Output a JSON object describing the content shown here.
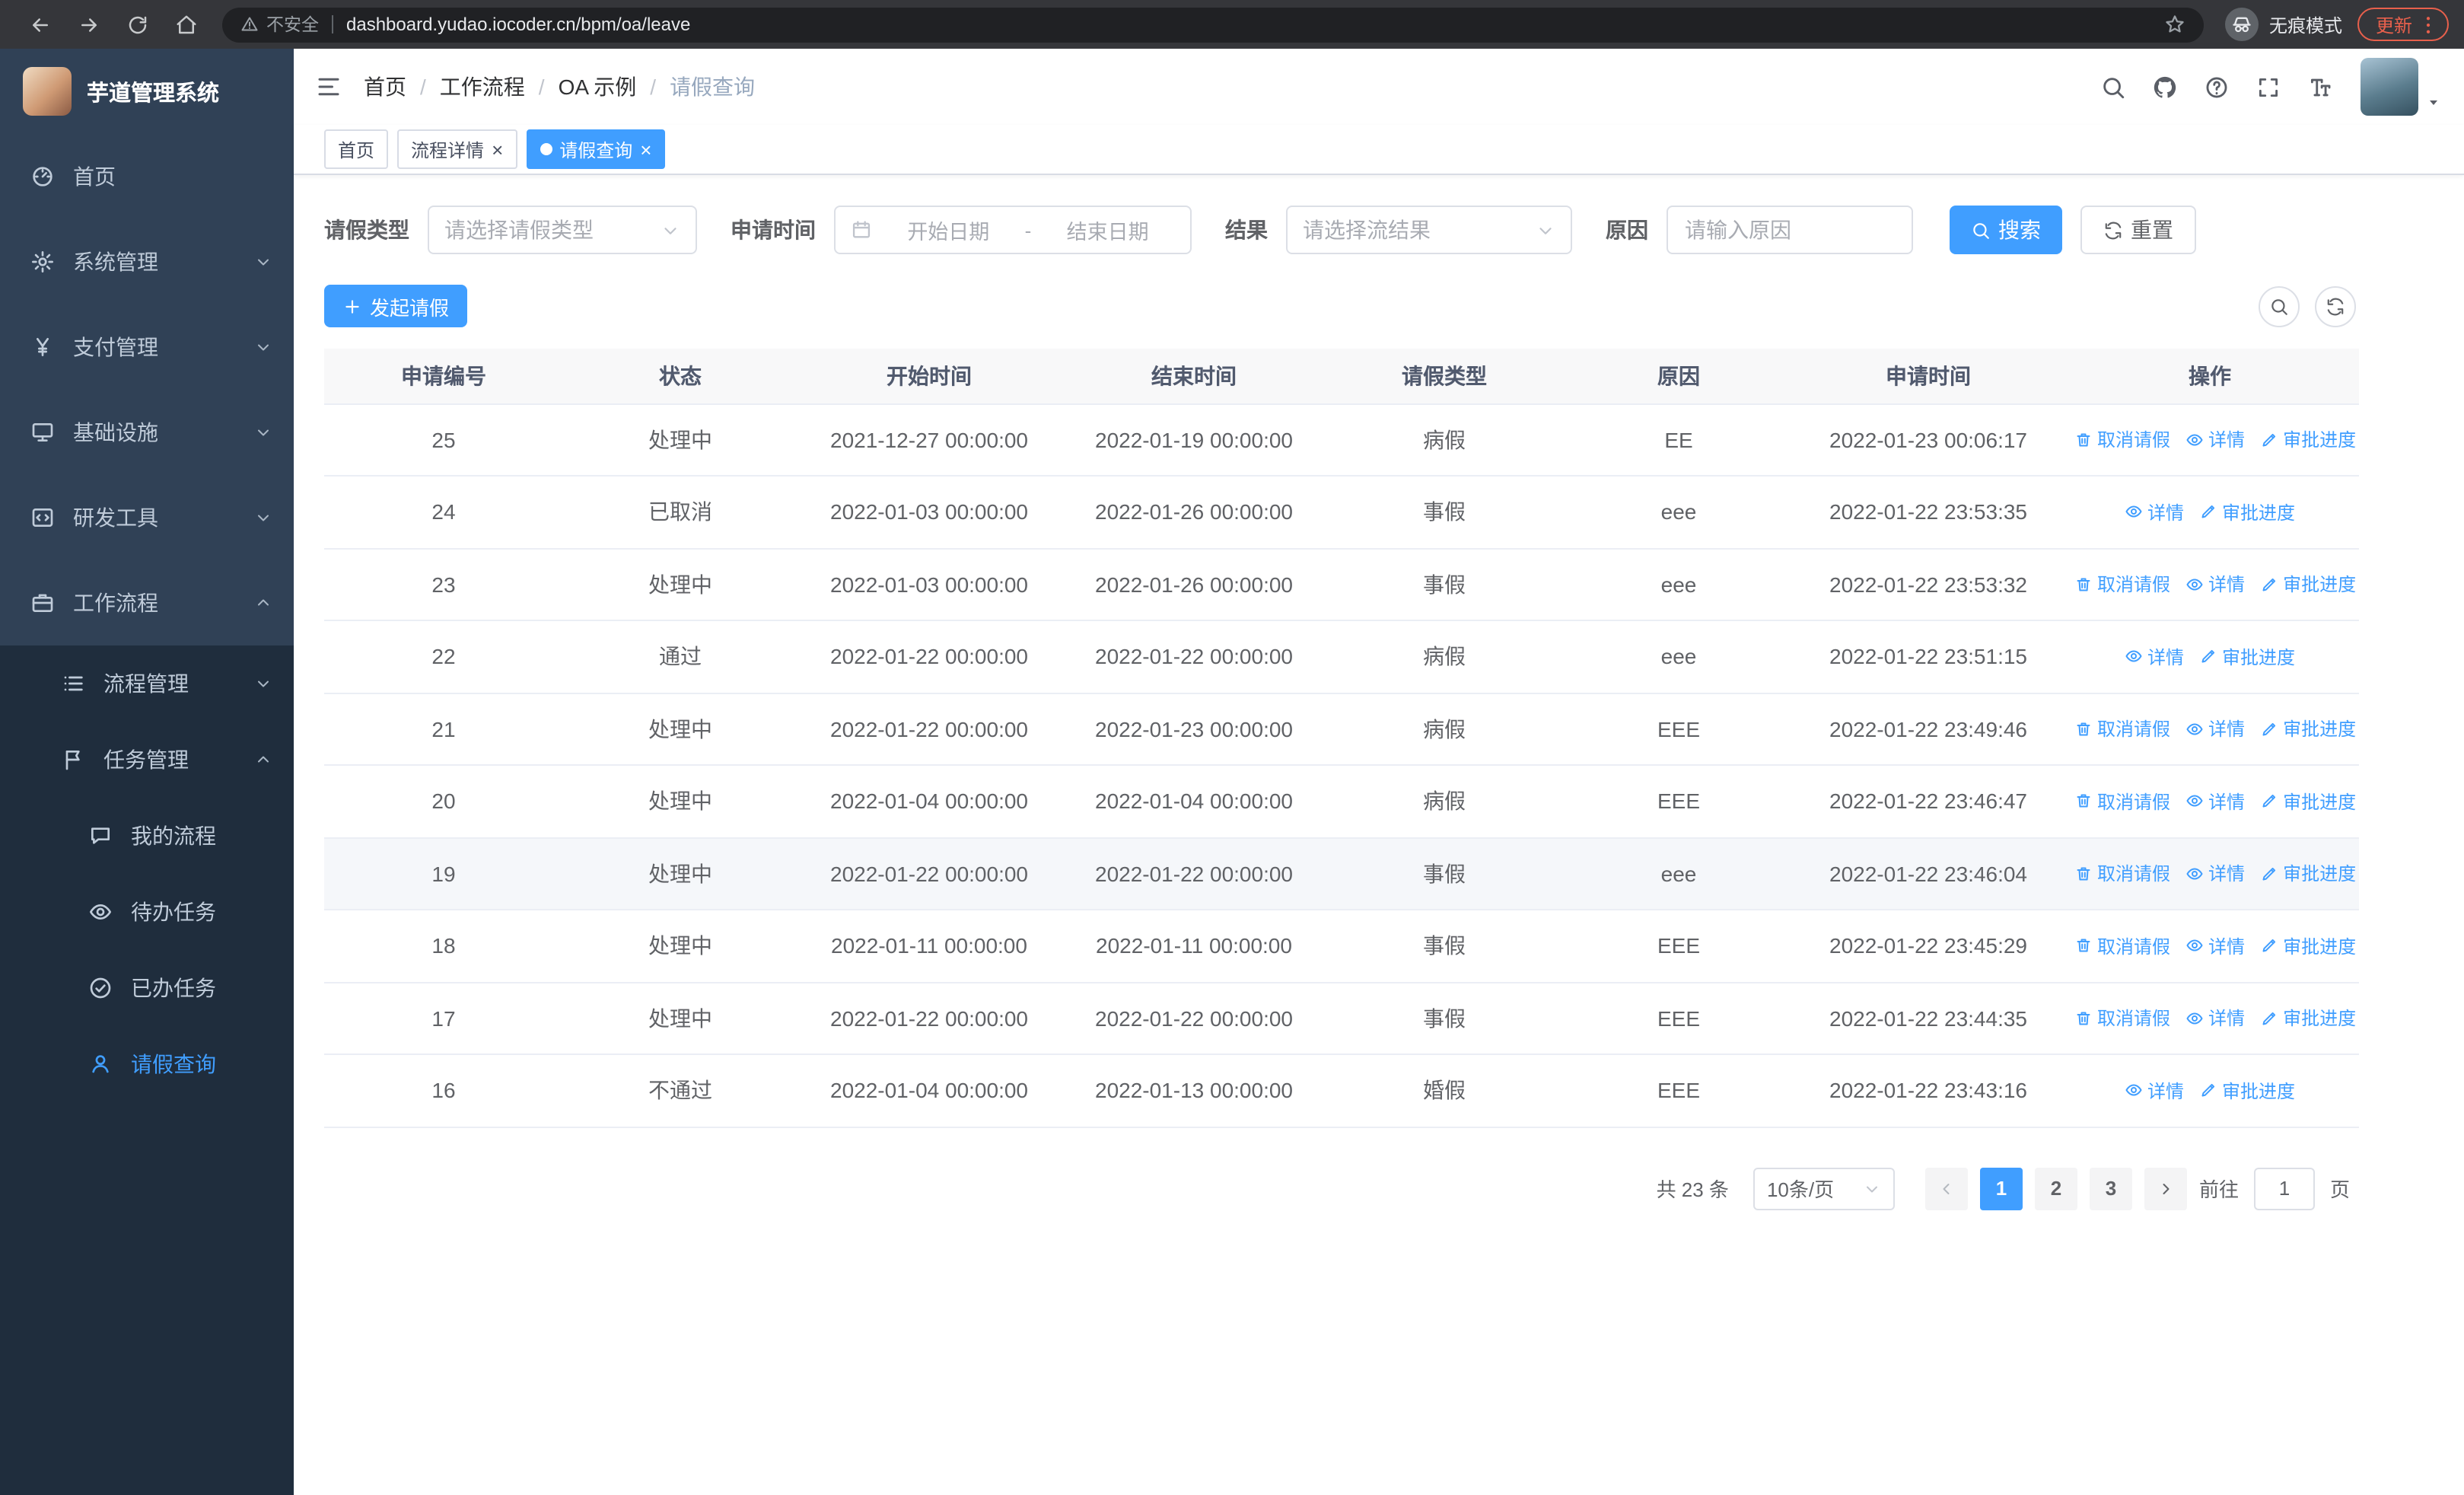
{
  "browser": {
    "security_warning": "不安全",
    "url": "dashboard.yudao.iocoder.cn/bpm/oa/leave",
    "incognito_label": "无痕模式",
    "update_label": "更新"
  },
  "sidebar": {
    "logo_title": "芋道管理系统",
    "items": [
      {
        "name": "home",
        "label": "首页",
        "icon": "dashboard-icon",
        "level": 0
      },
      {
        "name": "system-management",
        "label": "系统管理",
        "icon": "gear-icon",
        "level": 0,
        "arrow": "down"
      },
      {
        "name": "payment-management",
        "label": "支付管理",
        "icon": "yen-icon",
        "level": 0,
        "arrow": "down"
      },
      {
        "name": "infrastructure",
        "label": "基础设施",
        "icon": "monitor-icon",
        "level": 0,
        "arrow": "down"
      },
      {
        "name": "dev-tools",
        "label": "研发工具",
        "icon": "devtools-icon",
        "level": 0,
        "arrow": "down"
      },
      {
        "name": "workflow",
        "label": "工作流程",
        "icon": "briefcase-icon",
        "level": 0,
        "arrow": "up"
      },
      {
        "name": "process-management",
        "label": "流程管理",
        "icon": "list-icon",
        "level": 1,
        "arrow": "down"
      },
      {
        "name": "task-management",
        "label": "任务管理",
        "icon": "flag-icon",
        "level": 1,
        "arrow": "up"
      },
      {
        "name": "my-process",
        "label": "我的流程",
        "icon": "chat-icon",
        "level": 2
      },
      {
        "name": "todo-tasks",
        "label": "待办任务",
        "icon": "eye-icon",
        "level": 2
      },
      {
        "name": "done-tasks",
        "label": "已办任务",
        "icon": "check-circle-icon",
        "level": 2
      },
      {
        "name": "leave-query",
        "label": "请假查询",
        "icon": "user-icon",
        "level": 2,
        "active": true
      }
    ]
  },
  "header": {
    "breadcrumb": [
      "首页",
      "工作流程",
      "OA 示例",
      "请假查询"
    ]
  },
  "tabs": [
    {
      "label": "首页",
      "closable": false,
      "active": false
    },
    {
      "label": "流程详情",
      "closable": true,
      "active": false
    },
    {
      "label": "请假查询",
      "closable": true,
      "active": true
    }
  ],
  "filters": {
    "leave_type_label": "请假类型",
    "leave_type_placeholder": "请选择请假类型",
    "apply_time_label": "申请时间",
    "start_date_placeholder": "开始日期",
    "date_separator": "-",
    "end_date_placeholder": "结束日期",
    "result_label": "结果",
    "result_placeholder": "请选择流结果",
    "reason_label": "原因",
    "reason_placeholder": "请输入原因",
    "search_label": "搜索",
    "reset_label": "重置"
  },
  "toolbar": {
    "create_label": "发起请假"
  },
  "actions": {
    "cancel": {
      "label": "取消请假",
      "icon": "trash-icon"
    },
    "detail": {
      "label": "详情",
      "icon": "eye-icon"
    },
    "progress": {
      "label": "审批进度",
      "icon": "edit-icon"
    }
  },
  "table": {
    "columns": [
      "申请编号",
      "状态",
      "开始时间",
      "结束时间",
      "请假类型",
      "原因",
      "申请时间",
      "操作"
    ],
    "rows": [
      {
        "id": "25",
        "status": "处理中",
        "start": "2021-12-27 00:00:00",
        "end": "2022-01-19 00:00:00",
        "type": "病假",
        "reason": "EE",
        "applied": "2022-01-23 00:06:17",
        "actions": [
          "cancel",
          "detail",
          "progress"
        ]
      },
      {
        "id": "24",
        "status": "已取消",
        "start": "2022-01-03 00:00:00",
        "end": "2022-01-26 00:00:00",
        "type": "事假",
        "reason": "eee",
        "applied": "2022-01-22 23:53:35",
        "actions": [
          "detail",
          "progress"
        ]
      },
      {
        "id": "23",
        "status": "处理中",
        "start": "2022-01-03 00:00:00",
        "end": "2022-01-26 00:00:00",
        "type": "事假",
        "reason": "eee",
        "applied": "2022-01-22 23:53:32",
        "actions": [
          "cancel",
          "detail",
          "progress"
        ]
      },
      {
        "id": "22",
        "status": "通过",
        "start": "2022-01-22 00:00:00",
        "end": "2022-01-22 00:00:00",
        "type": "病假",
        "reason": "eee",
        "applied": "2022-01-22 23:51:15",
        "actions": [
          "detail",
          "progress"
        ]
      },
      {
        "id": "21",
        "status": "处理中",
        "start": "2022-01-22 00:00:00",
        "end": "2022-01-23 00:00:00",
        "type": "病假",
        "reason": "EEE",
        "applied": "2022-01-22 23:49:46",
        "actions": [
          "cancel",
          "detail",
          "progress"
        ]
      },
      {
        "id": "20",
        "status": "处理中",
        "start": "2022-01-04 00:00:00",
        "end": "2022-01-04 00:00:00",
        "type": "病假",
        "reason": "EEE",
        "applied": "2022-01-22 23:46:47",
        "actions": [
          "cancel",
          "detail",
          "progress"
        ]
      },
      {
        "id": "19",
        "status": "处理中",
        "start": "2022-01-22 00:00:00",
        "end": "2022-01-22 00:00:00",
        "type": "事假",
        "reason": "eee",
        "applied": "2022-01-22 23:46:04",
        "actions": [
          "cancel",
          "detail",
          "progress"
        ],
        "highlighted": true
      },
      {
        "id": "18",
        "status": "处理中",
        "start": "2022-01-11 00:00:00",
        "end": "2022-01-11 00:00:00",
        "type": "事假",
        "reason": "EEE",
        "applied": "2022-01-22 23:45:29",
        "actions": [
          "cancel",
          "detail",
          "progress"
        ]
      },
      {
        "id": "17",
        "status": "处理中",
        "start": "2022-01-22 00:00:00",
        "end": "2022-01-22 00:00:00",
        "type": "事假",
        "reason": "EEE",
        "applied": "2022-01-22 23:44:35",
        "actions": [
          "cancel",
          "detail",
          "progress"
        ]
      },
      {
        "id": "16",
        "status": "不通过",
        "start": "2022-01-04 00:00:00",
        "end": "2022-01-13 00:00:00",
        "type": "婚假",
        "reason": "EEE",
        "applied": "2022-01-22 23:43:16",
        "actions": [
          "detail",
          "progress"
        ]
      }
    ]
  },
  "pagination": {
    "total_text": "共 23 条",
    "page_size": "10条/页",
    "pages": [
      "1",
      "2",
      "3"
    ],
    "active_page": "1",
    "goto_prefix": "前往",
    "goto_value": "1",
    "goto_suffix": "页"
  }
}
